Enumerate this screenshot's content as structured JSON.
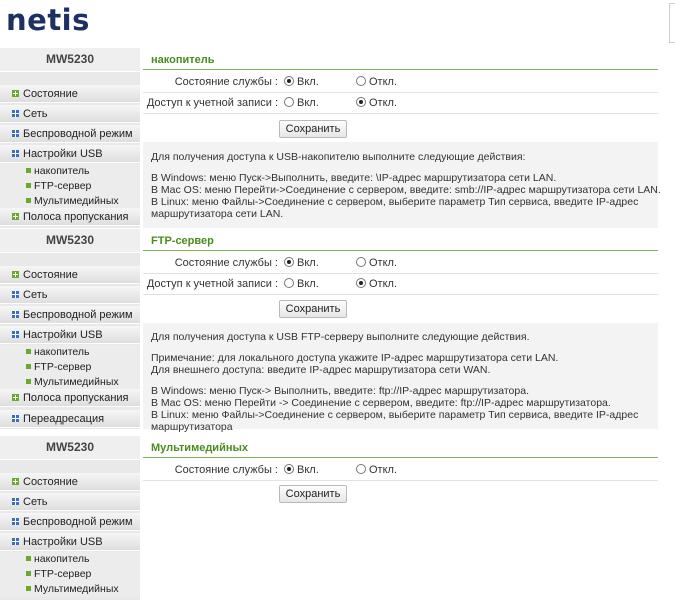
{
  "header": {
    "logo": "netis"
  },
  "panels": [
    {
      "sidebar": {
        "title": "MW5230",
        "items": [
          "Состояние",
          "Сеть",
          "Беспроводной режим",
          "Настройки USB"
        ],
        "sub_items": [
          "накопитель",
          "FTP-сервер",
          "Мультимедийных"
        ],
        "after_items": [
          "Полоса пропускания"
        ]
      },
      "section": {
        "title": "накопитель",
        "rows": [
          {
            "label": "Состояние службы :",
            "on": "Вкл.",
            "off": "Откл.",
            "selected": "on"
          },
          {
            "label": "Доступ к учетной записи :",
            "on": "Вкл.",
            "off": "Откл.",
            "selected": "off"
          }
        ],
        "save_label": "Сохранить",
        "info": [
          "Для получения доступа к USB-накопителю выполните следующие действия:",
          "",
          " В Windows: меню Пуск->Выполнить, введите: \\IP-адрес маршрутизатора сети LAN.",
          "В Mac OS: меню Перейти->Соединение с сервером, введите: smb://IP-адрес маршрутизатора сети LAN.",
          "В Linux: меню Файлы->Соединение с сервером, выберите параметр Тип сервиса, введите IP-адрес",
          "маршрутизатора сети LAN."
        ]
      }
    },
    {
      "sidebar": {
        "title": "MW5230",
        "items": [
          "Состояние",
          "Сеть",
          "Беспроводной режим",
          "Настройки USB"
        ],
        "sub_items": [
          "накопитель",
          "FTP-сервер",
          "Мультимедийных"
        ],
        "after_items": [
          "Полоса пропускания",
          "Переадресация"
        ]
      },
      "section": {
        "title": "FTP-сервер",
        "rows": [
          {
            "label": "Состояние службы :",
            "on": "Вкл.",
            "off": "Откл.",
            "selected": "on"
          },
          {
            "label": "Доступ к учетной записи :",
            "on": "Вкл.",
            "off": "Откл.",
            "selected": "off"
          }
        ],
        "save_label": "Сохранить",
        "info": [
          "Для получения доступа к USB FTP-серверу выполните следующие действия.",
          "",
          "Примечание: для локального доступа укажите IP-адрес маршрутизатора сети LAN.",
          "Для внешнего доступа: введите IP-адрес маршрутизатора сети WAN.",
          "",
          "В Windows: меню Пуск-> Выполнить, введите: ftp://IP-адрес маршрутизатора.",
          "В Mac OS: меню Перейти -> Соединение с сервером, введите: ftp://IP-адрес маршрутизатора.",
          "В Linux: меню Файлы->Соединение с сервером, выберите параметр Тип сервиса, введите IP-адрес",
          "маршрутизатора"
        ]
      }
    },
    {
      "sidebar": {
        "title": "MW5230",
        "items": [
          "Состояние",
          "Сеть",
          "Беспроводной режим",
          "Настройки USB"
        ],
        "sub_items": [
          "накопитель",
          "FTP-сервер",
          "Мультимедийных"
        ],
        "after_items": []
      },
      "section": {
        "title": "Мультимедийных",
        "rows": [
          {
            "label": "Состояние службы :",
            "on": "Вкл.",
            "off": "Откл.",
            "selected": "on"
          }
        ],
        "save_label": "Сохранить",
        "info": []
      }
    }
  ]
}
